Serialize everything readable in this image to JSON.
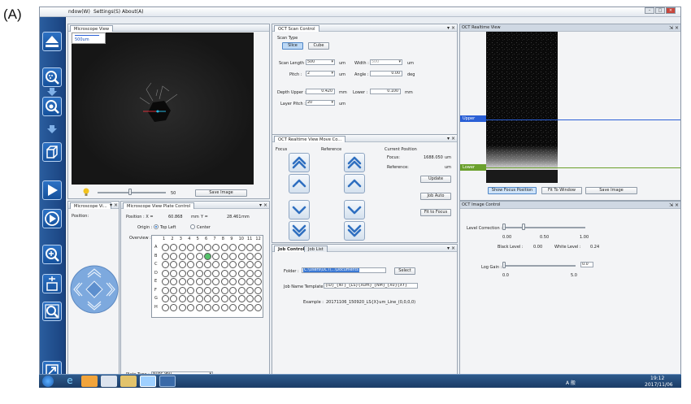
{
  "figure_label": "(A)",
  "menu": {
    "window": "ndow(W)",
    "settings": "Settings(S)",
    "about": "About(A)"
  },
  "microscope_view": {
    "tab": "Microscope View",
    "scale_label": "500um",
    "slider_value": "50",
    "save_button": "Save Image"
  },
  "microscope_small": {
    "tab": "Microscope Vi...",
    "position_label": "Position:"
  },
  "plate_control": {
    "tab": "Microscope View Plate Control",
    "position_x_label": "Position : X =",
    "position_x_value": "60.868",
    "mm1": "mm",
    "y_label": "Y =",
    "y_value": "28.461",
    "mm2": "mm",
    "origin_label": "Origin :",
    "origin_top_left": "Top Left",
    "origin_center": "Center",
    "overview_label": "Overview :",
    "columns": [
      "1",
      "2",
      "3",
      "4",
      "5",
      "6",
      "7",
      "8",
      "9",
      "10",
      "11",
      "12"
    ],
    "rows": [
      "A",
      "B",
      "C",
      "D",
      "E",
      "F",
      "G",
      "H"
    ],
    "selected_well": "B6",
    "plate_type_label": "Plate Type :",
    "plate_type_value": "Nunc 96U"
  },
  "scan_control": {
    "tab": "OCT Scan Control",
    "scan_type_label": "Scan Type",
    "slice": "Slice",
    "cube": "Cube",
    "scan_length_label": "Scan Length :",
    "scan_length_value": "500",
    "um1": "um",
    "width_label": "Width :",
    "width_value": "500",
    "um2": "um",
    "pitch_label": "Pitch :",
    "pitch_value": "2",
    "um3": "um",
    "angle_label": "Angle :",
    "angle_value": "0.00",
    "deg": "deg",
    "depth_upper_label": "Depth Upper :",
    "depth_upper_value": "0.420",
    "mm_a": "mm",
    "lower_label": "Lower :",
    "lower_value": "0.100",
    "mm_b": "mm",
    "layer_pitch_label": "Layer Pitch :",
    "layer_pitch_value": "20",
    "um4": "um"
  },
  "move_control": {
    "tab": "OCT Realtime View Move Co...",
    "focus_label": "Focus",
    "reference_label": "Reference",
    "current_position_label": "Current Position",
    "focus_pos_label": "Focus:",
    "focus_pos_value": "1688.050",
    "um_f": "um",
    "reference_pos_label": "Reference:",
    "reference_pos_value": "",
    "um_r": "um",
    "update": "Update",
    "job_auto": "Job Auto",
    "fit_to_focus": "Fit to Focus"
  },
  "job_control": {
    "tab_control": "Job Control",
    "tab_list": "Job List",
    "folder_label": "Folder :",
    "folder_value": "C:\\Users\\OCT\\...\\Documents",
    "select": "Select",
    "template_label": "Job Name Template :",
    "template_value": "{ID}_{NT}_{LS}{Xum}_{NM}_{X0}{XY}",
    "example_label": "Example :",
    "example_value": "20171106_150920_LS{X}um_Line_(0,0,0,0)"
  },
  "realtime_view": {
    "tab": "OCT Realtime View",
    "upper_label": "Upper",
    "lower_label": "Lower",
    "show_focus": "Show Focus Position",
    "fit_window": "Fit To Window",
    "save_image": "Save Image"
  },
  "image_control": {
    "tab": "OCT Image Control",
    "level_correction_label": "Level Correction :",
    "ticks": [
      "0.00",
      "0.50",
      "1.00"
    ],
    "black_level_label": "Black Level :",
    "black_level_value": "0.00",
    "white_level_label": "White Level :",
    "white_level_value": "0.24",
    "log_gain_label": "Log Gain :",
    "log_gain_value": "0.0",
    "gain_min": "0.0",
    "gain_max": "5.0"
  },
  "taskbar": {
    "time": "19:12",
    "date": "2017/11/06",
    "ime": "A 般"
  },
  "colors": {
    "upper_line": "#2a5fd6",
    "lower_line": "#6aa02c",
    "accent": "#1c6fd1",
    "well_selected": "#55c26a"
  }
}
